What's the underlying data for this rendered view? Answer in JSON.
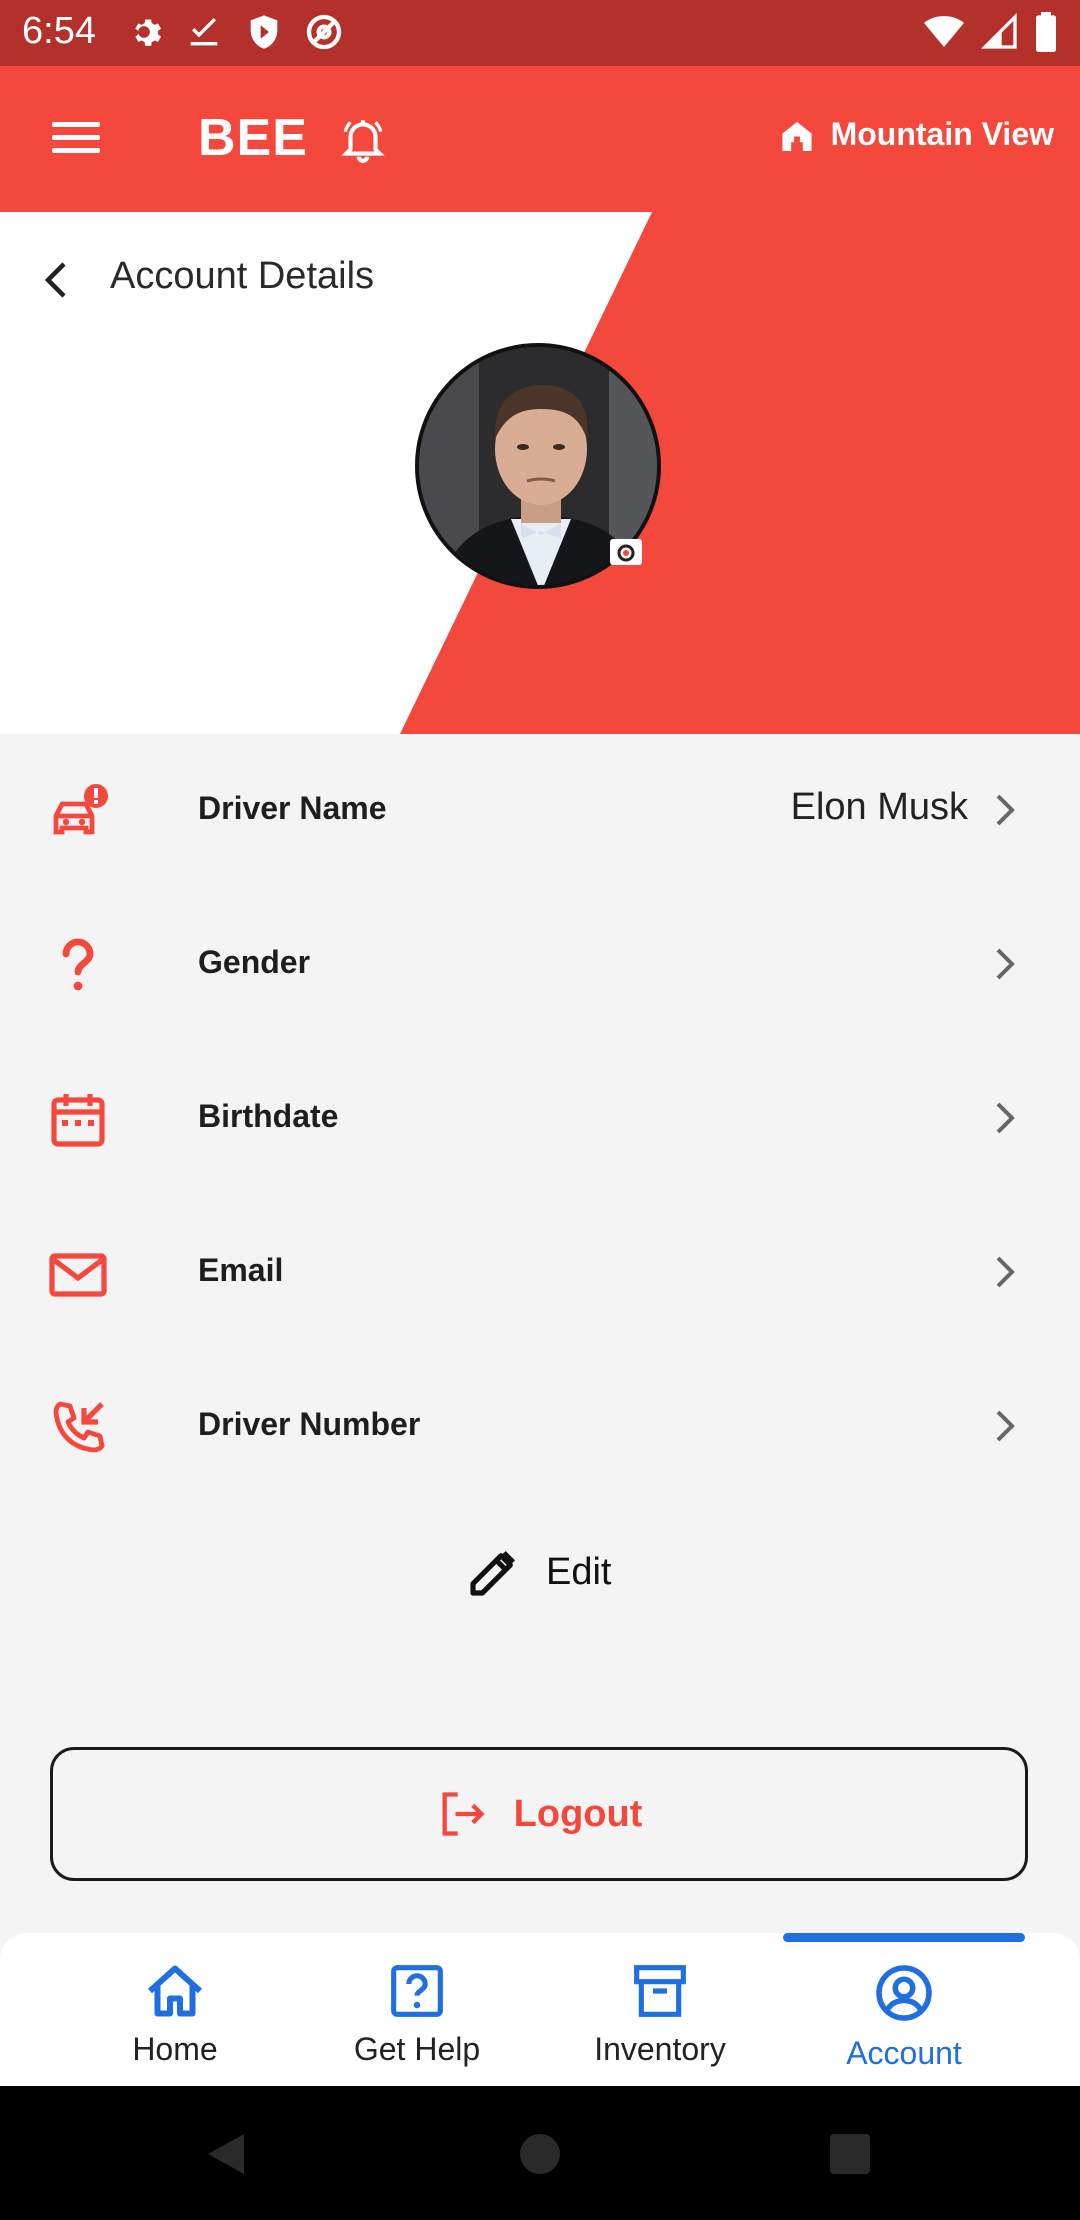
{
  "status_bar": {
    "time": "6:54"
  },
  "app_bar": {
    "brand": "BEE",
    "location": "Mountain View"
  },
  "page": {
    "title": "Account Details"
  },
  "colors": {
    "accent": "#f4483c",
    "active_nav": "#1f6fe0",
    "status_bar": "#b3312a"
  },
  "rows": [
    {
      "label": "Driver Name",
      "value": "Elon Musk",
      "icon": "car-alert-icon"
    },
    {
      "label": "Gender",
      "value": "",
      "icon": "question-icon"
    },
    {
      "label": "Birthdate",
      "value": "",
      "icon": "calendar-icon"
    },
    {
      "label": "Email",
      "value": "",
      "icon": "mail-icon"
    },
    {
      "label": "Driver Number",
      "value": "",
      "icon": "phone-incoming-icon"
    }
  ],
  "actions": {
    "edit": "Edit",
    "logout": "Logout"
  },
  "bottom_nav": [
    {
      "label": "Home",
      "icon": "home-icon"
    },
    {
      "label": "Get Help",
      "icon": "help-box-icon"
    },
    {
      "label": "Inventory",
      "icon": "archive-icon"
    },
    {
      "label": "Account",
      "icon": "account-circle-icon",
      "active": true
    }
  ]
}
